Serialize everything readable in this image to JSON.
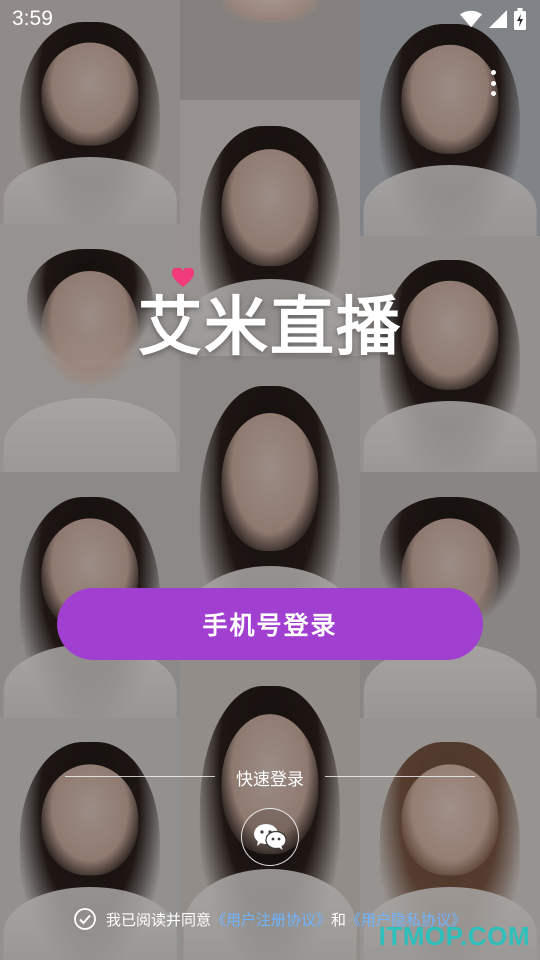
{
  "status_bar": {
    "time": "3:59"
  },
  "logo": {
    "text": "艾米直播"
  },
  "login": {
    "phone_button_label": "手机号登录"
  },
  "quick_login": {
    "label": "快速登录",
    "wechat_icon": "wechat-icon"
  },
  "agreement": {
    "prefix": "我已阅读并同意",
    "user_agreement": "《用户注册协议》",
    "conjunction": "和",
    "privacy_policy": "《用户隐私协议》"
  },
  "watermark": {
    "text": "ITMOP.COM"
  },
  "colors": {
    "accent": "#a13fd0",
    "link": "#6fb4ff",
    "heart": "#f03a7a",
    "watermark": "#22c4c0"
  }
}
